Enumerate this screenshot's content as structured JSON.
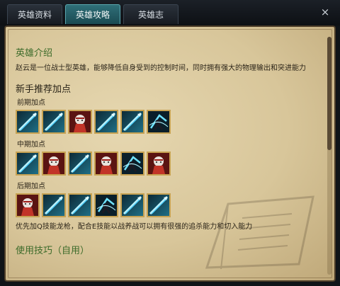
{
  "tabs": [
    {
      "label": "英雄资料"
    },
    {
      "label": "英雄攻略"
    },
    {
      "label": "英雄志"
    }
  ],
  "close_icon": "×",
  "intro": {
    "heading": "英雄介绍",
    "text": "赵云是一位战士型英雄，能够降低自身受到的控制时间，同时拥有强大的物理输出和突进能力"
  },
  "build": {
    "heading": "新手推荐加点",
    "phases": [
      {
        "label": "前期加点",
        "skills": [
          "Q",
          "Q",
          "W",
          "Q",
          "Q",
          "E"
        ]
      },
      {
        "label": "中期加点",
        "skills": [
          "Q",
          "W",
          "Q",
          "W",
          "E",
          "W"
        ]
      },
      {
        "label": "后期加点",
        "skills": [
          "W",
          "Q",
          "Q",
          "E",
          "Q",
          "Q"
        ]
      }
    ],
    "note": "优先加Q技能龙枪，配合E技能以战养战可以拥有很强的追杀能力和切入能力"
  },
  "tips": {
    "heading": "使用技巧（自用）"
  },
  "colors": {
    "tab_active": "#2f6f78",
    "heading_green": "#3c6b2a",
    "icon_border": "#c7a252"
  }
}
